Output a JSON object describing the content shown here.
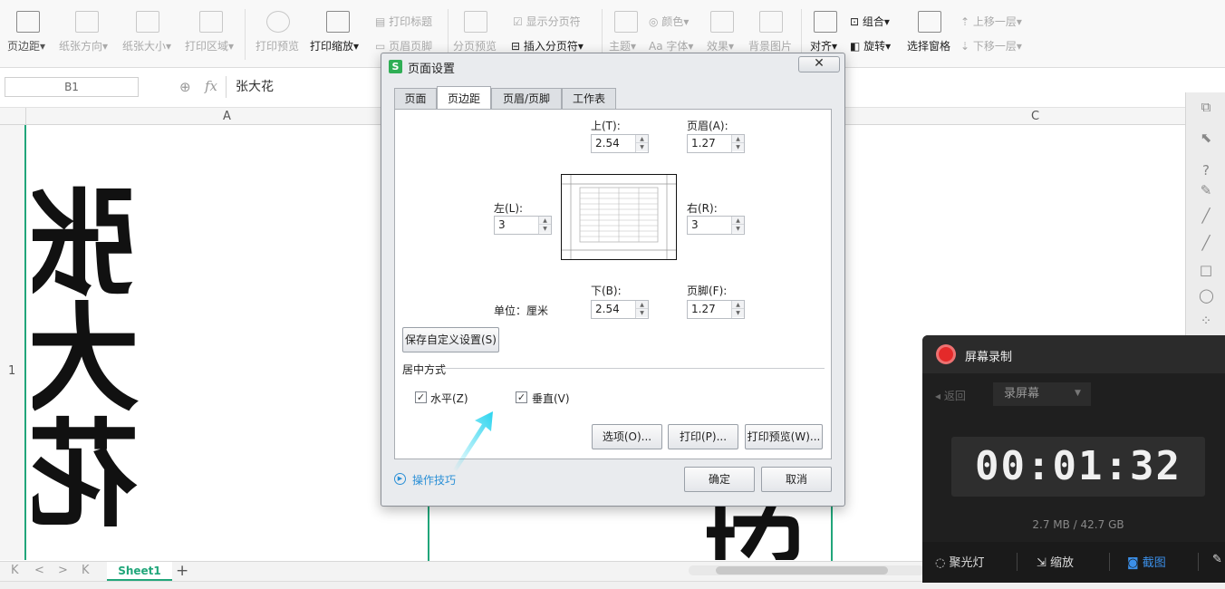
{
  "ribbon": {
    "items": [
      {
        "label": "页边距",
        "suffix": "▾"
      },
      {
        "label": "纸张方向",
        "suffix": "▾"
      },
      {
        "label": "纸张大小",
        "suffix": "▾"
      },
      {
        "label": "打印区域",
        "suffix": "▾"
      },
      {
        "label": "打印预览",
        "suffix": ""
      },
      {
        "label": "打印缩放",
        "suffix": "▾"
      }
    ],
    "small": {
      "print_title": "打印标题",
      "header_footer": "页眉页脚",
      "page_break_preview": "分页预览",
      "show_page_break": "显示分页符",
      "insert_page_break": "插入分页符",
      "theme": "主题",
      "color": "颜色",
      "font": "字体",
      "effect": "效果",
      "bg_image": "背景图片",
      "align": "对齐",
      "group": "组合",
      "rotate": "旋转",
      "selection_pane": "选择窗格",
      "bring_forward": "上移一层",
      "send_backward": "下移一层"
    }
  },
  "formula": {
    "name_box": "B1",
    "fx": "fx",
    "content": "张大花"
  },
  "grid": {
    "columns": [
      "A",
      "C"
    ],
    "row": "1",
    "cell_a1": "张大花",
    "cell_b1_partial": "花"
  },
  "sheets": {
    "nav": [
      "K",
      "<",
      ">",
      "K"
    ],
    "tab": "Sheet1",
    "add": "+"
  },
  "dialog": {
    "title": "页面设置",
    "logo": "S",
    "close": "✕",
    "tabs": [
      "页面",
      "页边距",
      "页眉/页脚",
      "工作表"
    ],
    "active_tab": "页边距",
    "top_label": "上(T):",
    "top_value": "2.54",
    "header_label": "页眉(A):",
    "header_value": "1.27",
    "left_label": "左(L):",
    "left_value": "3",
    "right_label": "右(R):",
    "right_value": "3",
    "bottom_label": "下(B):",
    "bottom_value": "2.54",
    "footer_label": "页脚(F):",
    "footer_value": "1.27",
    "unit_label": "单位：厘米",
    "save_custom": "保存自定义设置(S)",
    "center_section": "居中方式",
    "horizontal": "水平(Z)",
    "vertical": "垂直(V)",
    "horizontal_checked": true,
    "vertical_checked": true,
    "options_button": "选项(O)...",
    "print_button": "打印(P)...",
    "preview_button": "打印预览(W)...",
    "tips": "操作技巧",
    "ok": "确定",
    "cancel": "取消"
  },
  "recorder": {
    "title": "屏幕录制",
    "back": "◂ 返回",
    "mode": "录屏幕",
    "timer": "00:01:32",
    "size": "2.7 MB / 42.7 GB",
    "spotlight": "聚光灯",
    "zoom": "缩放",
    "screenshot": "截图"
  },
  "colors": {
    "accent_green": "#21a67a",
    "link_blue": "#2a8fd6",
    "record_red": "#e42a2a",
    "arrow_cyan": "#2ad4ef"
  }
}
